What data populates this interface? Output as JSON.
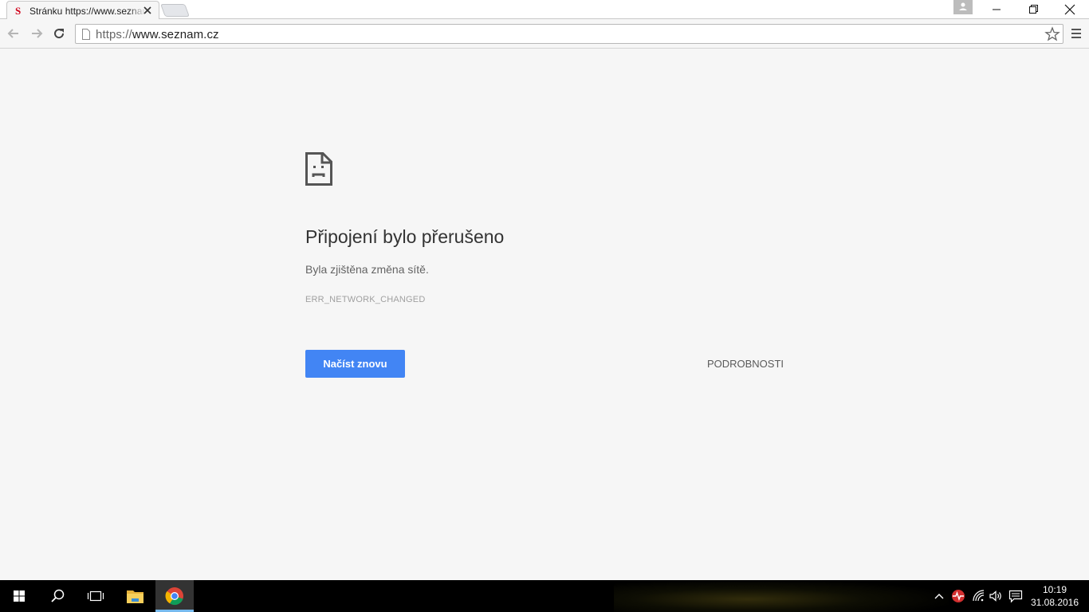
{
  "browser": {
    "tab": {
      "favicon": "S",
      "title": "Stránku https://www.seznam.cz"
    },
    "address_bar": {
      "scheme": "https://",
      "host": "www.seznam.cz"
    }
  },
  "error_page": {
    "heading": "Připojení bylo přerušeno",
    "description": "Byla zjištěna změna sítě.",
    "error_code": "ERR_NETWORK_CHANGED",
    "reload_label": "Načíst znovu",
    "details_label": "PODROBNOSTI"
  },
  "taskbar": {
    "clock_time": "10:19",
    "clock_date": "31.08.2016"
  },
  "icons": {
    "tab_close": "close-icon",
    "back": "arrow-left-icon",
    "forward": "arrow-right-icon",
    "reload": "reload-icon",
    "page": "page-icon",
    "bookmark": "star-icon",
    "menu": "hamburger-menu-icon",
    "error": "sad-document-icon",
    "start": "windows-logo-icon",
    "search": "search-icon",
    "task_view": "task-view-icon",
    "explorer": "folder-icon",
    "chrome": "chrome-icon"
  },
  "colors": {
    "accent_button": "#4285f4",
    "page_background": "#f6f6f6",
    "taskbar": "#000000",
    "favicon": "#d0021b"
  }
}
